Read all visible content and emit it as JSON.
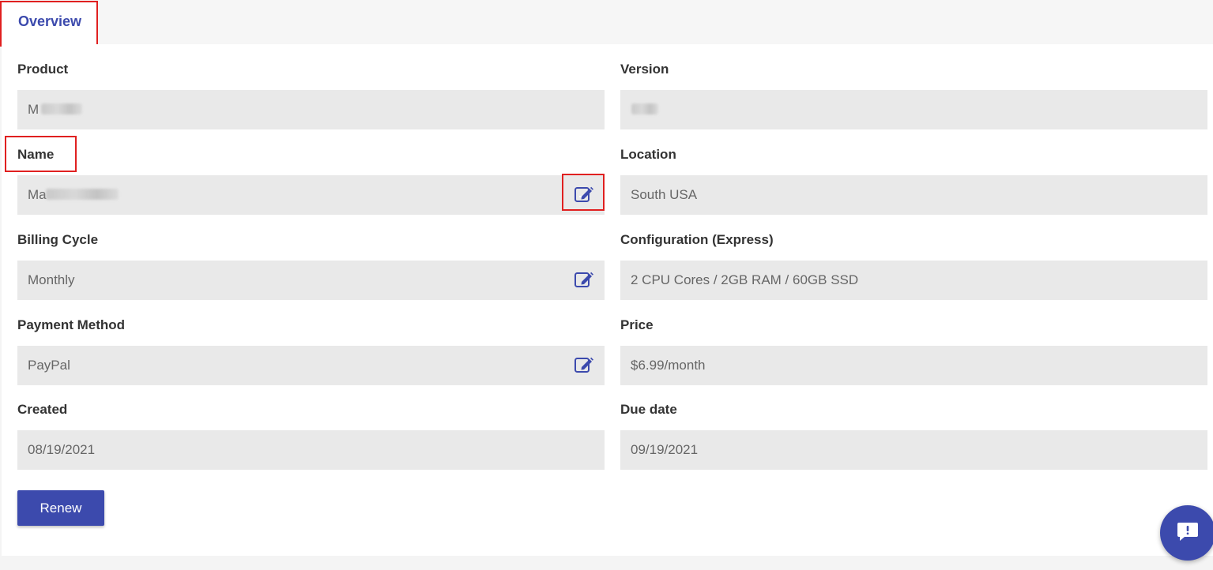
{
  "tabs": [
    {
      "label": "Overview",
      "active": true
    }
  ],
  "colors": {
    "accent": "#3c4aad",
    "highlight": "#e02020",
    "field_bg": "#e9e9e9"
  },
  "fields": {
    "product": {
      "label": "Product",
      "value": "M"
    },
    "version": {
      "label": "Version",
      "value": ""
    },
    "name": {
      "label": "Name",
      "value": "Ma",
      "editable": true
    },
    "location": {
      "label": "Location",
      "value": "South USA"
    },
    "billing_cycle": {
      "label": "Billing Cycle",
      "value": "Monthly",
      "editable": true
    },
    "configuration": {
      "label": "Configuration (Express)",
      "value": "2 CPU Cores / 2GB RAM / 60GB SSD"
    },
    "payment_method": {
      "label": "Payment Method",
      "value": "PayPal",
      "editable": true
    },
    "price": {
      "label": "Price",
      "value": "$6.99/month"
    },
    "created": {
      "label": "Created",
      "value": "08/19/2021"
    },
    "due_date": {
      "label": "Due date",
      "value": "09/19/2021"
    }
  },
  "actions": {
    "renew_label": "Renew"
  },
  "icons": {
    "edit": "edit-icon",
    "chat": "chat-alert-icon"
  }
}
